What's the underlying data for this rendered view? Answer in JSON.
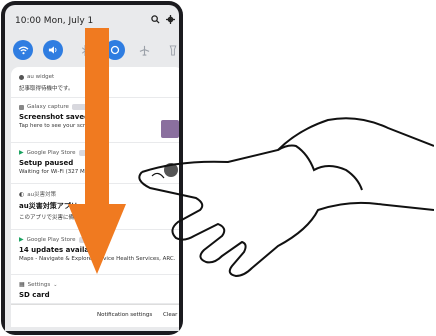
{
  "status": {
    "time_date": "10:00  Mon, July 1"
  },
  "icons": {
    "search": "search-icon",
    "settings": "gear-icon"
  },
  "quick_settings": [
    "wifi-icon",
    "sound-icon",
    "bluetooth-icon",
    "rotate-icon",
    "airplane-icon",
    "flashlight-icon"
  ],
  "notifications": [
    {
      "app": "au widget",
      "title": "",
      "text": "記事取得待機中です。"
    },
    {
      "app": "Galaxy capture",
      "title": "Screenshot saved",
      "text": "Tap here to see your scre"
    },
    {
      "app": "Google Play Store",
      "title": "Setup paused",
      "text": "Waiting for Wi-Fi (327 M"
    },
    {
      "app": "au災害対策",
      "title": "au災害対策アプリ",
      "text": "このアプリで災害に備"
    },
    {
      "app": "Google Play Store",
      "title": "14 updates available",
      "text": "Maps - Navigate & Explore, Device Health Services, ARC..."
    },
    {
      "app": "Settings",
      "title": "SD card",
      "text": ""
    }
  ],
  "footer": {
    "notification_settings": "Notification settings",
    "clear": "Clear"
  },
  "colors": {
    "accent": "#2f7de1",
    "arrow": "#f07a20",
    "play": "#1aa260"
  }
}
